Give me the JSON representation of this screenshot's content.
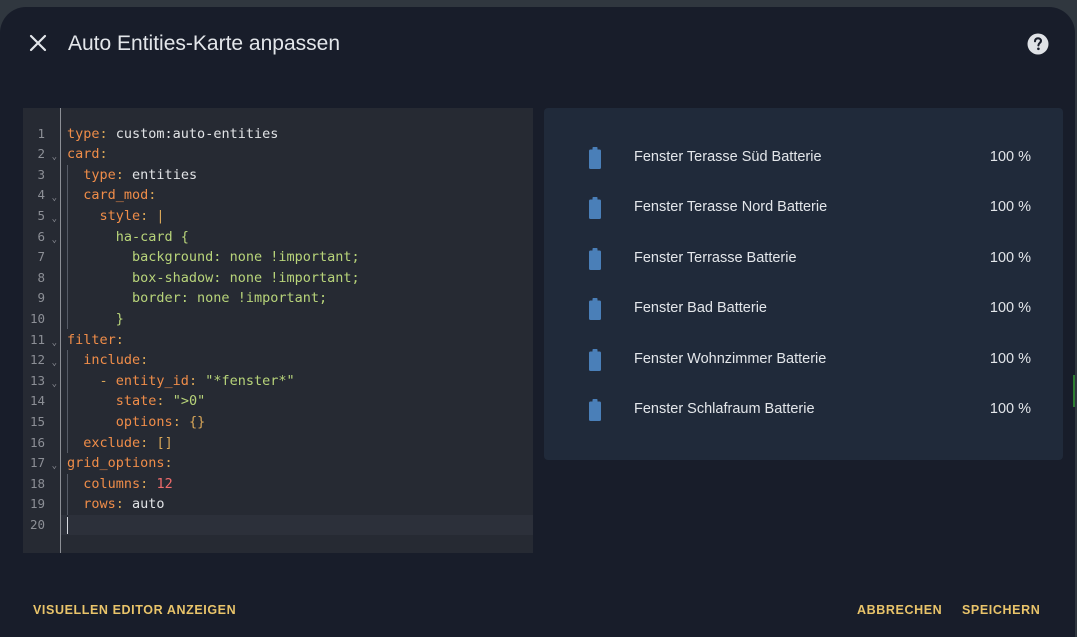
{
  "dialog": {
    "title": "Auto Entities-Karte anpassen",
    "help_icon": "help-circle-icon",
    "close_icon": "close-icon"
  },
  "editor": {
    "lines": [
      {
        "num": "1",
        "fold": false,
        "tokens": [
          {
            "t": "key",
            "v": "type"
          },
          {
            "t": "punct",
            "v": ":"
          },
          {
            "t": "val",
            "v": " custom:auto-entities"
          }
        ]
      },
      {
        "num": "2",
        "fold": true,
        "tokens": [
          {
            "t": "key",
            "v": "card"
          },
          {
            "t": "punct",
            "v": ":"
          }
        ]
      },
      {
        "num": "3",
        "fold": false,
        "tokens": [
          {
            "t": "val",
            "v": "  "
          },
          {
            "t": "key",
            "v": "type"
          },
          {
            "t": "punct",
            "v": ":"
          },
          {
            "t": "val",
            "v": " entities"
          }
        ]
      },
      {
        "num": "4",
        "fold": true,
        "tokens": [
          {
            "t": "val",
            "v": "  "
          },
          {
            "t": "key",
            "v": "card_mod"
          },
          {
            "t": "punct",
            "v": ":"
          }
        ]
      },
      {
        "num": "5",
        "fold": true,
        "tokens": [
          {
            "t": "val",
            "v": "    "
          },
          {
            "t": "key",
            "v": "style"
          },
          {
            "t": "punct",
            "v": ":"
          },
          {
            "t": "punct",
            "v": " |"
          }
        ]
      },
      {
        "num": "6",
        "fold": true,
        "tokens": [
          {
            "t": "val",
            "v": "      "
          },
          {
            "t": "str",
            "v": "ha-card {"
          }
        ]
      },
      {
        "num": "7",
        "fold": false,
        "tokens": [
          {
            "t": "val",
            "v": "        "
          },
          {
            "t": "str",
            "v": "background: none !important;"
          }
        ]
      },
      {
        "num": "8",
        "fold": false,
        "tokens": [
          {
            "t": "val",
            "v": "        "
          },
          {
            "t": "str",
            "v": "box-shadow: none !important;"
          }
        ]
      },
      {
        "num": "9",
        "fold": false,
        "tokens": [
          {
            "t": "val",
            "v": "        "
          },
          {
            "t": "str",
            "v": "border: none !important;"
          }
        ]
      },
      {
        "num": "10",
        "fold": false,
        "tokens": [
          {
            "t": "val",
            "v": "      "
          },
          {
            "t": "str",
            "v": "}"
          }
        ]
      },
      {
        "num": "11",
        "fold": true,
        "tokens": [
          {
            "t": "key",
            "v": "filter"
          },
          {
            "t": "punct",
            "v": ":"
          }
        ]
      },
      {
        "num": "12",
        "fold": true,
        "tokens": [
          {
            "t": "val",
            "v": "  "
          },
          {
            "t": "key",
            "v": "include"
          },
          {
            "t": "punct",
            "v": ":"
          }
        ]
      },
      {
        "num": "13",
        "fold": true,
        "tokens": [
          {
            "t": "val",
            "v": "    "
          },
          {
            "t": "punct",
            "v": "- "
          },
          {
            "t": "key",
            "v": "entity_id"
          },
          {
            "t": "punct",
            "v": ":"
          },
          {
            "t": "str",
            "v": " \"*fenster*\""
          }
        ]
      },
      {
        "num": "14",
        "fold": false,
        "tokens": [
          {
            "t": "val",
            "v": "      "
          },
          {
            "t": "key",
            "v": "state"
          },
          {
            "t": "punct",
            "v": ":"
          },
          {
            "t": "str",
            "v": " \">0\""
          }
        ]
      },
      {
        "num": "15",
        "fold": false,
        "tokens": [
          {
            "t": "val",
            "v": "      "
          },
          {
            "t": "key",
            "v": "options"
          },
          {
            "t": "punct",
            "v": ":"
          },
          {
            "t": "punct",
            "v": " {}"
          }
        ]
      },
      {
        "num": "16",
        "fold": false,
        "tokens": [
          {
            "t": "val",
            "v": "  "
          },
          {
            "t": "key",
            "v": "exclude"
          },
          {
            "t": "punct",
            "v": ":"
          },
          {
            "t": "punct",
            "v": " []"
          }
        ]
      },
      {
        "num": "17",
        "fold": true,
        "tokens": [
          {
            "t": "key",
            "v": "grid_options"
          },
          {
            "t": "punct",
            "v": ":"
          }
        ]
      },
      {
        "num": "18",
        "fold": false,
        "tokens": [
          {
            "t": "val",
            "v": "  "
          },
          {
            "t": "key",
            "v": "columns"
          },
          {
            "t": "punct",
            "v": ":"
          },
          {
            "t": "num",
            "v": " 12"
          }
        ]
      },
      {
        "num": "19",
        "fold": false,
        "tokens": [
          {
            "t": "val",
            "v": "  "
          },
          {
            "t": "key",
            "v": "rows"
          },
          {
            "t": "punct",
            "v": ":"
          },
          {
            "t": "val",
            "v": " auto"
          }
        ]
      },
      {
        "num": "20",
        "fold": false,
        "tokens": []
      }
    ]
  },
  "preview": {
    "entities": [
      {
        "name": "Fenster Terasse Süd Batterie",
        "state": "100 %",
        "icon": "battery-icon"
      },
      {
        "name": "Fenster Terasse Nord Batterie",
        "state": "100 %",
        "icon": "battery-icon"
      },
      {
        "name": "Fenster Terrasse Batterie",
        "state": "100 %",
        "icon": "battery-icon"
      },
      {
        "name": "Fenster Bad Batterie",
        "state": "100 %",
        "icon": "battery-icon"
      },
      {
        "name": "Fenster Wohnzimmer Batterie",
        "state": "100 %",
        "icon": "battery-icon"
      },
      {
        "name": "Fenster Schlafraum Batterie",
        "state": "100 %",
        "icon": "battery-icon"
      }
    ]
  },
  "footer": {
    "visual_editor_label": "VISUELLEN EDITOR ANZEIGEN",
    "cancel_label": "ABBRECHEN",
    "save_label": "SPEICHERN"
  },
  "colors": {
    "accent": "#e9c46a",
    "yaml_key": "#f08d49",
    "yaml_string": "#b8d47a",
    "yaml_number": "#ee6b6b",
    "battery_icon": "#4a7fb8"
  }
}
